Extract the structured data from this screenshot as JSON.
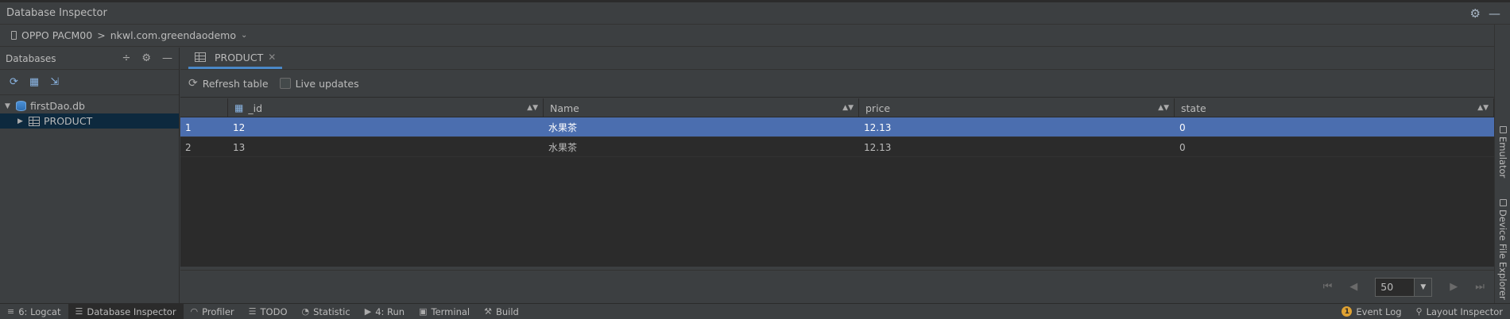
{
  "window": {
    "title": "Database Inspector"
  },
  "device_bar": {
    "device": "OPPO PACM00",
    "separator": ">",
    "app": "nkwl.com.greendaodemo"
  },
  "left_panel": {
    "header": "Databases",
    "tree": {
      "database": "firstDao.db",
      "table": "PRODUCT"
    }
  },
  "right_panel": {
    "tab": {
      "label": "PRODUCT"
    },
    "toolbar": {
      "refresh_label": "Refresh table",
      "live_updates_label": "Live updates",
      "live_updates_checked": false
    },
    "columns": [
      "_id",
      "Name",
      "price",
      "state"
    ],
    "rows": [
      {
        "index": "1",
        "_id": "12",
        "Name": "水果茶",
        "price": "12.13",
        "state": "0",
        "selected": true
      },
      {
        "index": "2",
        "_id": "13",
        "Name": "水果茶",
        "price": "12.13",
        "state": "0",
        "selected": false
      }
    ],
    "pagination": {
      "page_size": "50"
    }
  },
  "right_sidebar": {
    "tabs": [
      "Emulator",
      "Device File Explorer"
    ]
  },
  "status_bar": {
    "left": [
      {
        "label": "6: Logcat",
        "icon": "logcat-icon"
      },
      {
        "label": "Database Inspector",
        "icon": "database-icon",
        "active": true
      },
      {
        "label": "Profiler",
        "icon": "profiler-icon"
      },
      {
        "label": "TODO",
        "icon": "todo-icon"
      },
      {
        "label": "Statistic",
        "icon": "statistic-icon"
      },
      {
        "label": "4: Run",
        "icon": "run-icon"
      },
      {
        "label": "Terminal",
        "icon": "terminal-icon"
      },
      {
        "label": "Build",
        "icon": "build-icon"
      }
    ],
    "right": [
      {
        "label": "Event Log",
        "icon": "warning-badge-icon",
        "badge": "1"
      },
      {
        "label": "Layout Inspector",
        "icon": "layout-inspector-icon"
      }
    ]
  },
  "colors": {
    "background": "#3c3f41",
    "grid_background": "#2b2b2b",
    "selection": "#4b6eaf",
    "accent": "#4a88c7"
  }
}
